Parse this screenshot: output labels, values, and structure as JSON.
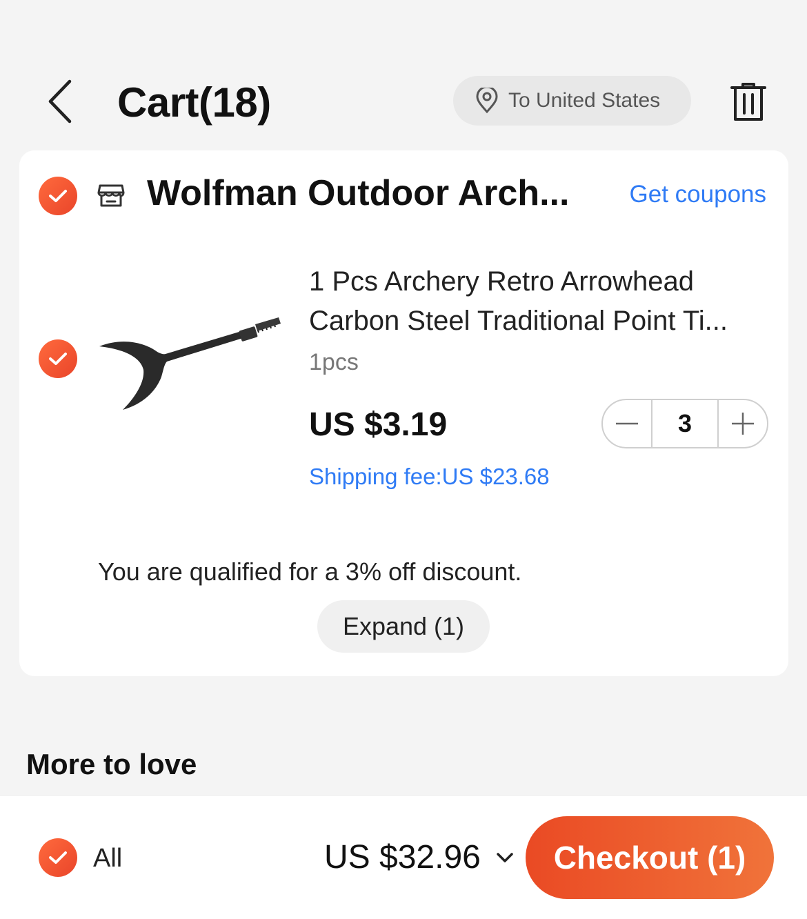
{
  "header": {
    "title": "Cart(18)",
    "ship_to": "To United States"
  },
  "store": {
    "name": "Wolfman Outdoor Arch...",
    "coupons_link": "Get coupons"
  },
  "item": {
    "title": "1 Pcs Archery Retro Arrowhead Carbon Steel Traditional Point Ti...",
    "sku": "1pcs",
    "price": "US $3.19",
    "quantity": "3",
    "shipping": "Shipping fee:US $23.68"
  },
  "discount": {
    "text": "You are qualified for a 3% off discount.",
    "expand_label": "Expand (1)"
  },
  "more_to_love": "More to love",
  "footer": {
    "all_label": "All",
    "total": "US $32.96",
    "checkout_label": "Checkout (1)"
  },
  "colors": {
    "accent_orange": "#ea4a24",
    "link_blue": "#2f7bf5"
  },
  "icons": [
    "back-arrow-icon",
    "location-pin-icon",
    "trash-icon",
    "check-icon",
    "store-icon",
    "minus-icon",
    "plus-icon",
    "chevron-down-icon"
  ]
}
